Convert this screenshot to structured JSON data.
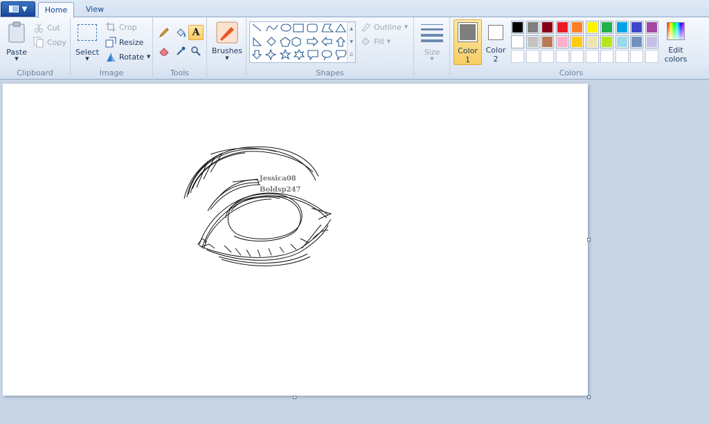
{
  "tabs": {
    "home": "Home",
    "view": "View"
  },
  "clipboard": {
    "paste": "Paste",
    "cut": "Cut",
    "copy": "Copy",
    "group": "Clipboard"
  },
  "image": {
    "select": "Select",
    "crop": "Crop",
    "resize": "Resize",
    "rotate": "Rotate",
    "group": "Image"
  },
  "tools": {
    "group": "Tools"
  },
  "brushes": {
    "label": "Brushes"
  },
  "shapes": {
    "outline": "Outline",
    "fill": "Fill",
    "group": "Shapes"
  },
  "size": {
    "label": "Size"
  },
  "colors": {
    "color1": "Color",
    "color1_num": "1",
    "color2": "Color",
    "color2_num": "2",
    "edit1": "Edit",
    "edit2": "colors",
    "group": "Colors",
    "color1_value": "#7f7f7f",
    "color2_value": "#ffffff",
    "palette_row1": [
      "#000000",
      "#7f7f7f",
      "#880015",
      "#ed1c24",
      "#ff7f27",
      "#fff200",
      "#22b14c",
      "#00a2e8",
      "#3f48cc",
      "#a349a4"
    ],
    "palette_row2": [
      "#ffffff",
      "#c3c3c3",
      "#b97a57",
      "#ffaec9",
      "#ffc90e",
      "#efe4b0",
      "#b5e61d",
      "#99d9ea",
      "#7092be",
      "#c8bfe7"
    ]
  },
  "canvas": {
    "signature_line1": "Jessica08",
    "signature_line2": "Boldsp247"
  }
}
